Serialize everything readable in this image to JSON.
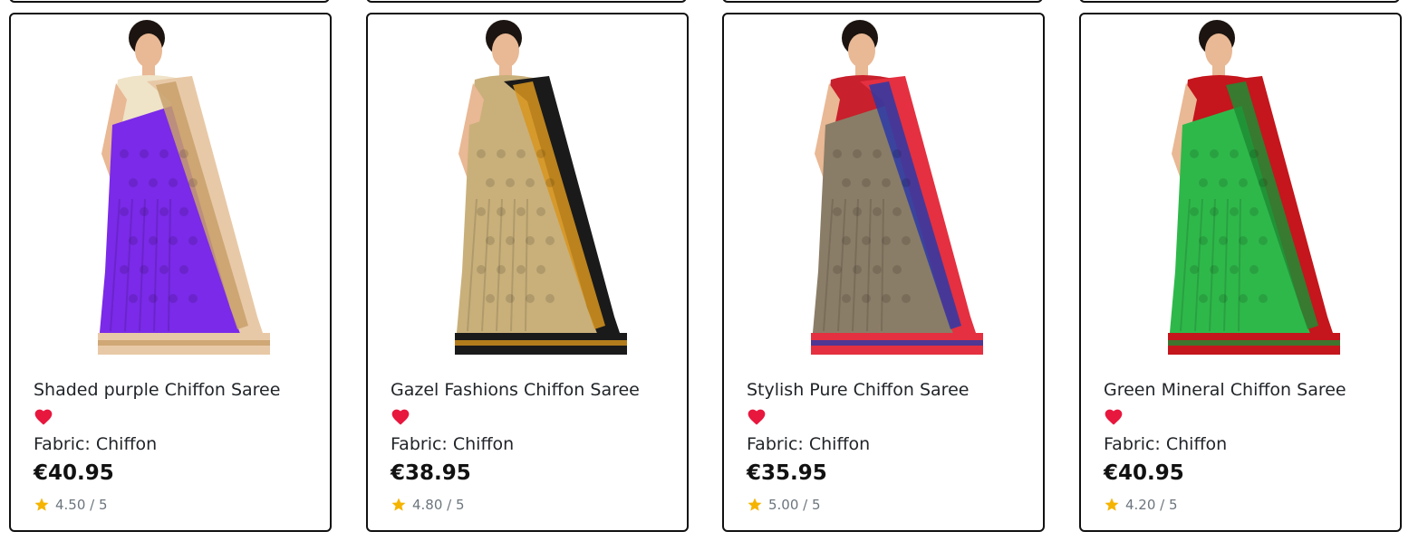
{
  "products": [
    {
      "title": "Shaded purple Chiffon Saree",
      "fabric": "Fabric: Chiffon",
      "price": "€40.95",
      "rating": "4.50 / 5",
      "image_colors": {
        "main": "#7a2ae8",
        "border": "#e8c9a7",
        "accent": "#c8a06a",
        "blouse": "#efe3c8"
      }
    },
    {
      "title": "Gazel Fashions Chiffon Saree",
      "fabric": "Fabric: Chiffon",
      "price": "€38.95",
      "rating": "4.80 / 5",
      "image_colors": {
        "main": "#c9b07a",
        "border": "#1a1a1a",
        "accent": "#d8951e",
        "blouse": "#c9b07a"
      }
    },
    {
      "title": "Stylish Pure Chiffon Saree",
      "fabric": "Fabric: Chiffon",
      "price": "€35.95",
      "rating": "5.00 / 5",
      "image_colors": {
        "main": "#8a7d67",
        "border": "#e43040",
        "accent": "#2b3aa8",
        "blouse": "#c8202c"
      }
    },
    {
      "title": "Green Mineral Chiffon Saree",
      "fabric": "Fabric: Chiffon",
      "price": "€40.95",
      "rating": "4.20 / 5",
      "image_colors": {
        "main": "#2fb84a",
        "border": "#c4161c",
        "accent": "#1e8c34",
        "blouse": "#c4161c"
      }
    }
  ],
  "colors": {
    "heart": "#e8173e",
    "star": "#f5b400",
    "card_border": "#111111"
  },
  "icons": {
    "favorite": "heart-icon",
    "rating": "star-icon"
  }
}
